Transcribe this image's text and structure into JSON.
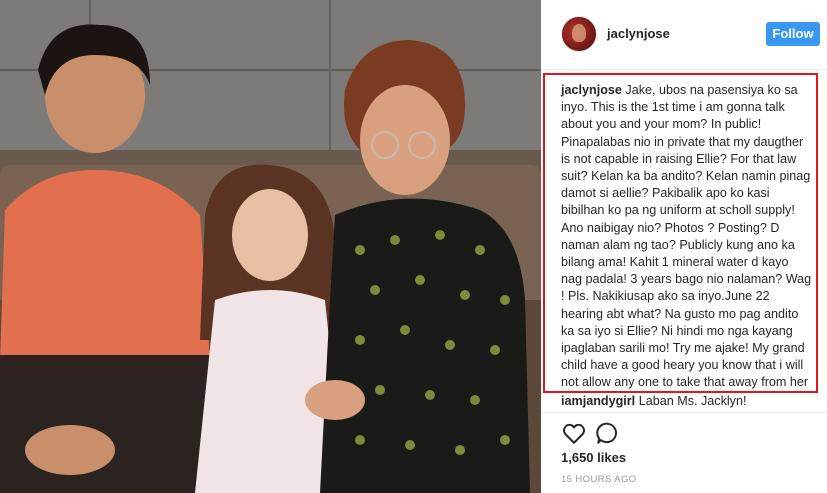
{
  "post": {
    "username": "jaclynjose",
    "follow_label": "Follow",
    "caption_user": "jaclynjose",
    "caption_text": "Jake, ubos na pasensiya ko sa inyo. This is the 1st time i am gonna talk about you and your mom? In public! Pinapalabas nio in private that my daugther is not capable in raising Ellie? For that law suit? Kelan ka ba andito? Kelan namin pinag damot si aellie? Pakibalik apo ko kasi bibilhan ko pa ng uniform at scholl supply! Ano naibigay nio? Photos ? Posting? D naman alam ng tao? Publicly kung ano ka bilang ama! Kahit 1 mineral water d kayo nag padala! 3 years bago nio nalaman? Wag ! Pls. Nakikiusap ako sa inyo.June 22 hearing abt what? Na gusto mo pag andito ka sa iyo si Ellie? Ni hindi mo nga kayang ipaglaban sarili mo! Try me ajake! My grand child have a good heary you know that i will not allow any one to take that away from her",
    "comment_user": "iamjandygirl",
    "comment_text": "Laban Ms. Jacklyn!",
    "likes": "1,650 likes",
    "timestamp": "15 HOURS AGO",
    "accent_color": "#3897f0",
    "highlight_color": "#e3161c",
    "icons": [
      "heart-icon",
      "comment-icon"
    ]
  }
}
